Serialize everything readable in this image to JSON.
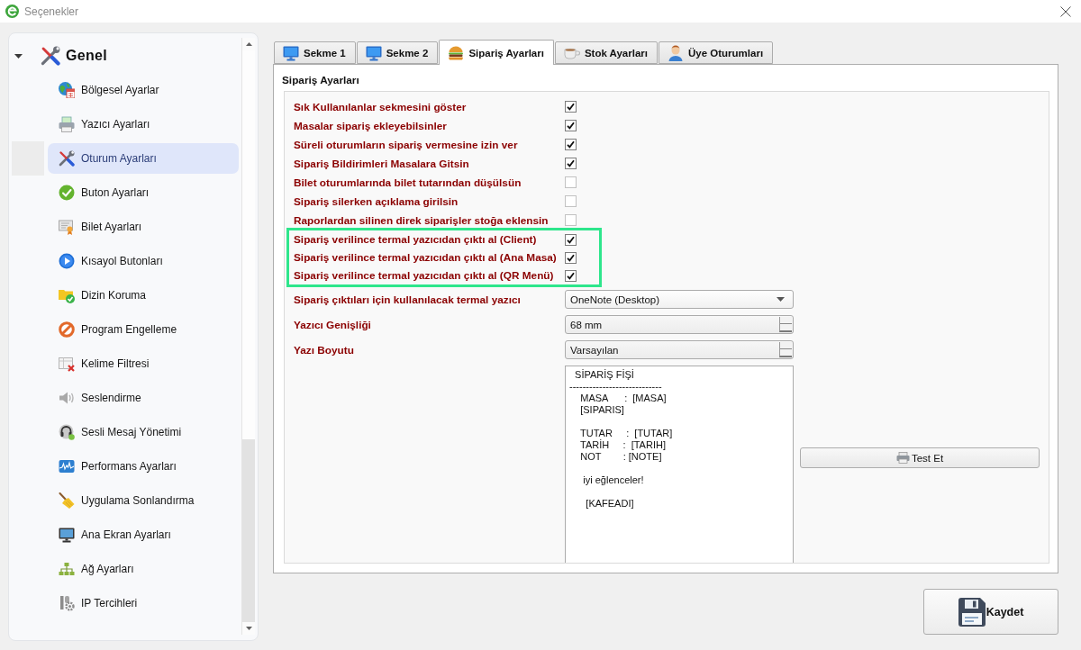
{
  "window": {
    "title": "Seçenekler"
  },
  "sidebar": {
    "items": [
      {
        "label": "Genel",
        "expanded": true,
        "children": [
          {
            "label": "Bölgesel Ayarlar",
            "selected": false
          },
          {
            "label": "Yazıcı Ayarları",
            "selected": false
          },
          {
            "label": "Oturum Ayarları",
            "selected": true
          },
          {
            "label": "Buton Ayarları",
            "selected": false
          },
          {
            "label": "Bilet Ayarları",
            "selected": false
          },
          {
            "label": "Kısayol Butonları",
            "selected": false
          },
          {
            "label": "Dizin Koruma",
            "selected": false
          },
          {
            "label": "Program Engelleme",
            "selected": false
          },
          {
            "label": "Kelime Filtresi",
            "selected": false
          },
          {
            "label": "Seslendirme",
            "selected": false
          },
          {
            "label": "Sesli Mesaj Yönetimi",
            "selected": false
          },
          {
            "label": "Performans Ayarları",
            "selected": false
          },
          {
            "label": "Uygulama Sonlandırma",
            "selected": false
          },
          {
            "label": "Ana Ekran Ayarları",
            "selected": false
          },
          {
            "label": "Ağ Ayarları",
            "selected": false
          },
          {
            "label": "IP Tercihleri",
            "selected": false
          }
        ]
      }
    ]
  },
  "tabs": [
    {
      "label": "Sekme 1",
      "selected": false
    },
    {
      "label": "Sekme 2",
      "selected": false
    },
    {
      "label": "Sipariş Ayarları",
      "selected": true
    },
    {
      "label": "Stok Ayarları",
      "selected": false
    },
    {
      "label": "Üye Oturumları",
      "selected": false
    }
  ],
  "panel": {
    "title": "Sipariş Ayarları",
    "options": [
      {
        "label": "Sık Kullanılanlar sekmesini göster",
        "checked": true,
        "highlighted": false
      },
      {
        "label": "Masalar sipariş ekleyebilsinler",
        "checked": true,
        "highlighted": false
      },
      {
        "label": "Süreli oturumların sipariş vermesine izin ver",
        "checked": true,
        "highlighted": false
      },
      {
        "label": "Sipariş Bildirimleri Masalara Gitsin",
        "checked": true,
        "highlighted": false
      },
      {
        "label": "Bilet oturumlarında bilet tutarından düşülsün",
        "checked": false,
        "highlighted": false
      },
      {
        "label": "Sipariş silerken açıklama girilsin",
        "checked": false,
        "highlighted": false
      },
      {
        "label": "Raporlardan silinen direk siparişler stoğa eklensin",
        "checked": false,
        "highlighted": false
      },
      {
        "label": "Sipariş verilince termal yazıcıdan çıktı al (Client)",
        "checked": true,
        "highlighted": true
      },
      {
        "label": "Sipariş verilince termal yazıcıdan çıktı al (Ana Masa)",
        "checked": true,
        "highlighted": true
      },
      {
        "label": "Sipariş verilince termal yazıcıdan çıktı al (QR Menü)",
        "checked": true,
        "highlighted": true
      }
    ],
    "fields": [
      {
        "kind": "dropdown",
        "label": "Sipariş çıktıları için kullanılacak termal yazıcı",
        "value": "OneNote (Desktop)"
      },
      {
        "kind": "spinner",
        "label": "Yazıcı Genişliği",
        "value": "68 mm"
      },
      {
        "kind": "spinner",
        "label": "Yazı Boyutu",
        "value": "Varsayılan"
      }
    ],
    "template": {
      "value": "  SİPARİŞ FİŞİ\n----------------------------\n    MASA      :  [MASA]\n    [SIPARIS]\n\n    TUTAR     :  [TUTAR]\n    TARİH     :  [TARIH]\n    NOT        : [NOTE]\n\n     iyi eğlenceler!\n\n      [KAFEADI]"
    },
    "test_button": {
      "label": "Test Et"
    }
  },
  "save_button": {
    "label": "Kaydet"
  }
}
